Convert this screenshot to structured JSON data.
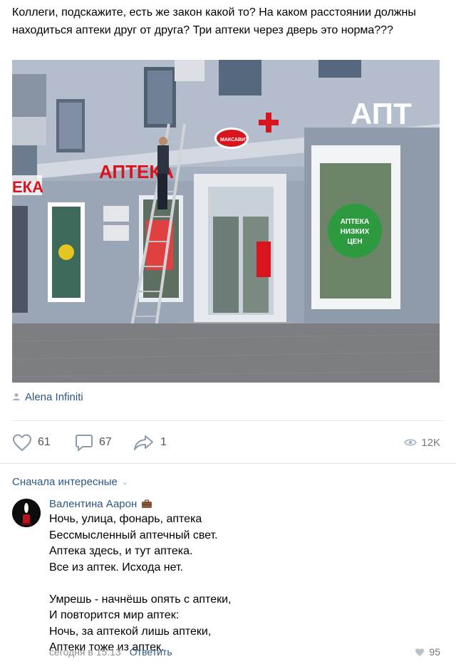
{
  "post": {
    "text": "Коллеги, подскажите, есть же закон какой то? На каком расстоянии должны находиться аптеки друг от друга? Три аптеки через дверь это норма???",
    "photo": {
      "sign_left": "АПТЕКА",
      "sign_mid": "АПТЕКА",
      "sign_right": "АПТ",
      "badge": "МАКСАВИТ",
      "window_circle": [
        "АПТЕКА",
        "НИЗКИХ",
        "ЦЕН"
      ]
    },
    "author": "Alena Infiniti",
    "likes": "61",
    "comments": "67",
    "shares": "1",
    "views": "12K"
  },
  "comments_section": {
    "sort_label": "Сначала интересные"
  },
  "comment": {
    "author": "Валентина Аарон",
    "stanza1": [
      "Ночь, улица, фонарь, аптека",
      "Бессмысленный аптечный свет.",
      "Аптека здесь, и тут аптека.",
      "Все из аптек. Исхода нет."
    ],
    "stanza2": [
      "Умрешь - начнёшь опять с аптеки,",
      "И повторится мир аптек:",
      "Ночь, за аптекой лишь аптеки,",
      "Аптеки тоже из аптек."
    ],
    "time": "сегодня в 15:13",
    "reply_label": "Ответить",
    "likes": "95"
  },
  "colors": {
    "link": "#2a5885",
    "muted": "#8a8f96",
    "sign_red": "#d8141f",
    "facade": "#9aa6b6"
  },
  "icons": [
    "person-icon",
    "heart-icon",
    "comment-icon",
    "share-icon",
    "eye-icon",
    "chevron-down-icon",
    "briefcase-icon"
  ]
}
